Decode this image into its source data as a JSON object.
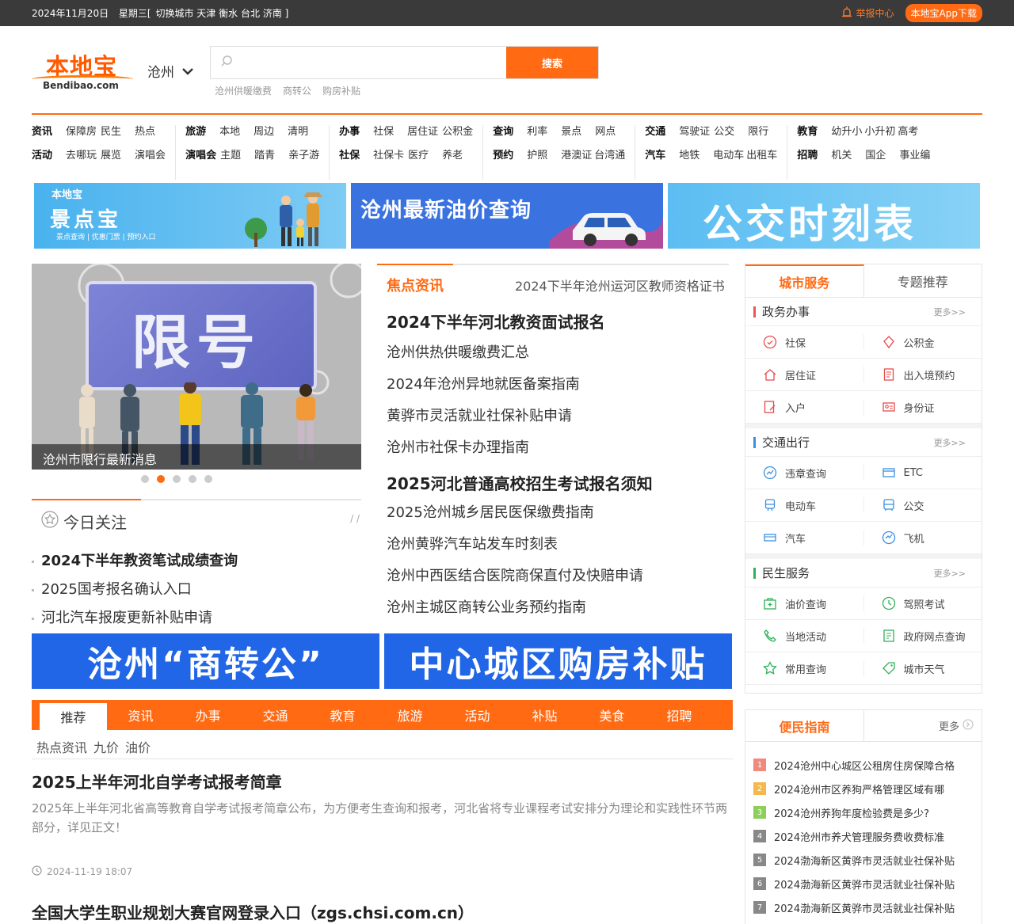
{
  "topbar": {
    "date": "2024年11月20日",
    "weekday": "星期三[",
    "switch_city": "切换城市",
    "cities": [
      "天津",
      "衡水",
      "台北",
      "济南"
    ],
    "close_bracket": "]",
    "report": "举报中心",
    "app_download": "本地宝App下载"
  },
  "header": {
    "logo_cn": "本地宝",
    "logo_en": "Bendibao.com",
    "city": "沧州",
    "search_placeholder": "",
    "search_button": "搜索",
    "hot_words": [
      "沧州供暖缴费",
      "商转公",
      "购房补贴"
    ]
  },
  "nav": [
    [
      [
        "资讯",
        "保障房",
        "民生",
        "热点"
      ],
      [
        "活动",
        "去哪玩",
        "展览",
        "演唱会"
      ]
    ],
    [
      [
        "旅游",
        "本地",
        "周边",
        "清明"
      ],
      [
        "演唱会",
        "主题",
        "踏青",
        "亲子游"
      ]
    ],
    [
      [
        "办事",
        "社保",
        "居住证",
        "公积金"
      ],
      [
        "社保",
        "社保卡",
        "医疗",
        "养老"
      ]
    ],
    [
      [
        "查询",
        "利率",
        "景点",
        "网点"
      ],
      [
        "预约",
        "护照",
        "港澳证",
        "台湾通"
      ]
    ],
    [
      [
        "交通",
        "驾驶证",
        "公交",
        "限行"
      ],
      [
        "汽车",
        "地铁",
        "电动车",
        "出租车"
      ]
    ],
    [
      [
        "教育",
        "幼升小",
        "小升初",
        "高考"
      ],
      [
        "招聘",
        "机关",
        "国企",
        "事业编"
      ]
    ]
  ],
  "banners_top": {
    "b1_small": "本地宝",
    "b1_title": "景点宝",
    "b1_sub": "景点查询 | 优惠门票 | 预约入口",
    "b2": "沧州最新油价查询",
    "b3": "公交时刻表"
  },
  "slider": {
    "board_text": "限号",
    "caption": "沧州市限行最新消息",
    "dot_count": 5,
    "active_dot": 2
  },
  "today": {
    "title": "今日关注",
    "slashes": "/ /",
    "items": [
      "2024下半年教资笔试成绩查询",
      "2025国考报名确认入口",
      "河北汽车报废更新补贴申请"
    ]
  },
  "news": {
    "title": "焦点资讯",
    "ticker": "2024下半年沧州运河区教师资格证书",
    "headline1": "2024下半年河北教资面试报名",
    "group1": [
      "沧州供热供暖缴费汇总",
      "2024年沧州异地就医备案指南",
      "黄骅市灵活就业社保补贴申请",
      "沧州市社保卡办理指南"
    ],
    "headline2": "2025河北普通高校招生考试报名须知",
    "group2": [
      "2025沧州城乡居民医保缴费指南",
      "沧州黄骅汽车站发车时刻表",
      "沧州中西医结合医院商保直付及快赔申请",
      "沧州主城区商转公业务预约指南"
    ]
  },
  "banners_mid": [
    "沧州“商转公”",
    "中心城区购房补贴"
  ],
  "tabs": [
    "推荐",
    "资讯",
    "办事",
    "交通",
    "教育",
    "旅游",
    "活动",
    "补贴",
    "美食",
    "招聘"
  ],
  "subtabs": [
    "热点资讯",
    "九价",
    "油价"
  ],
  "articles": [
    {
      "title": "2025上半年河北自学考试报考简章",
      "summary": "2025年上半年河北省高等教育自学考试报考简章公布，为方便考生查询和报考，河北省将专业课程考试安排分为理论和实践性环节两部分，详见正文！",
      "time": "2024-11-19 18:07"
    },
    {
      "title": "全国大学生职业规划大赛官网登录入口（zgs.chsi.com.cn）"
    }
  ],
  "city_service": {
    "tab_active": "城市服务",
    "tab_other": "专题推荐",
    "more": "更多>>",
    "sections": [
      {
        "name": "政务办事",
        "color": "#e84a4a",
        "items": [
          [
            "社保",
            "公积金"
          ],
          [
            "居住证",
            "出入境预约"
          ],
          [
            "入户",
            "身份证"
          ]
        ]
      },
      {
        "name": "交通出行",
        "color": "#3b8fe0",
        "items": [
          [
            "违章查询",
            "ETC"
          ],
          [
            "电动车",
            "公交"
          ],
          [
            "汽车",
            "飞机"
          ]
        ]
      },
      {
        "name": "民生服务",
        "color": "#2fb05a",
        "items": [
          [
            "油价查询",
            "驾照考试"
          ],
          [
            "当地活动",
            "政府网点查询"
          ],
          [
            "常用查询",
            "城市天气"
          ]
        ]
      }
    ]
  },
  "guide": {
    "title": "便民指南",
    "more": "更多",
    "items": [
      "2024沧州中心城区公租房住房保障合格",
      "2024沧州市区养狗严格管理区域有哪",
      "2024沧州养狗年度检验费是多少?",
      "2024沧州市养犬管理服务费收费标准",
      "2024渤海新区黄骅市灵活就业社保补贴",
      "2024渤海新区黄骅市灵活就业社保补贴",
      "2024渤海新区黄骅市灵活就业社保补贴"
    ],
    "badge_colors": [
      "#f08a7e",
      "#f5b84a",
      "#8ccf5a",
      "#888888",
      "#888888",
      "#888888",
      "#888888"
    ]
  },
  "colors": {
    "accent": "#ff6a13",
    "topbar": "#3a3a3a",
    "banner_blue": "#2166e6"
  }
}
